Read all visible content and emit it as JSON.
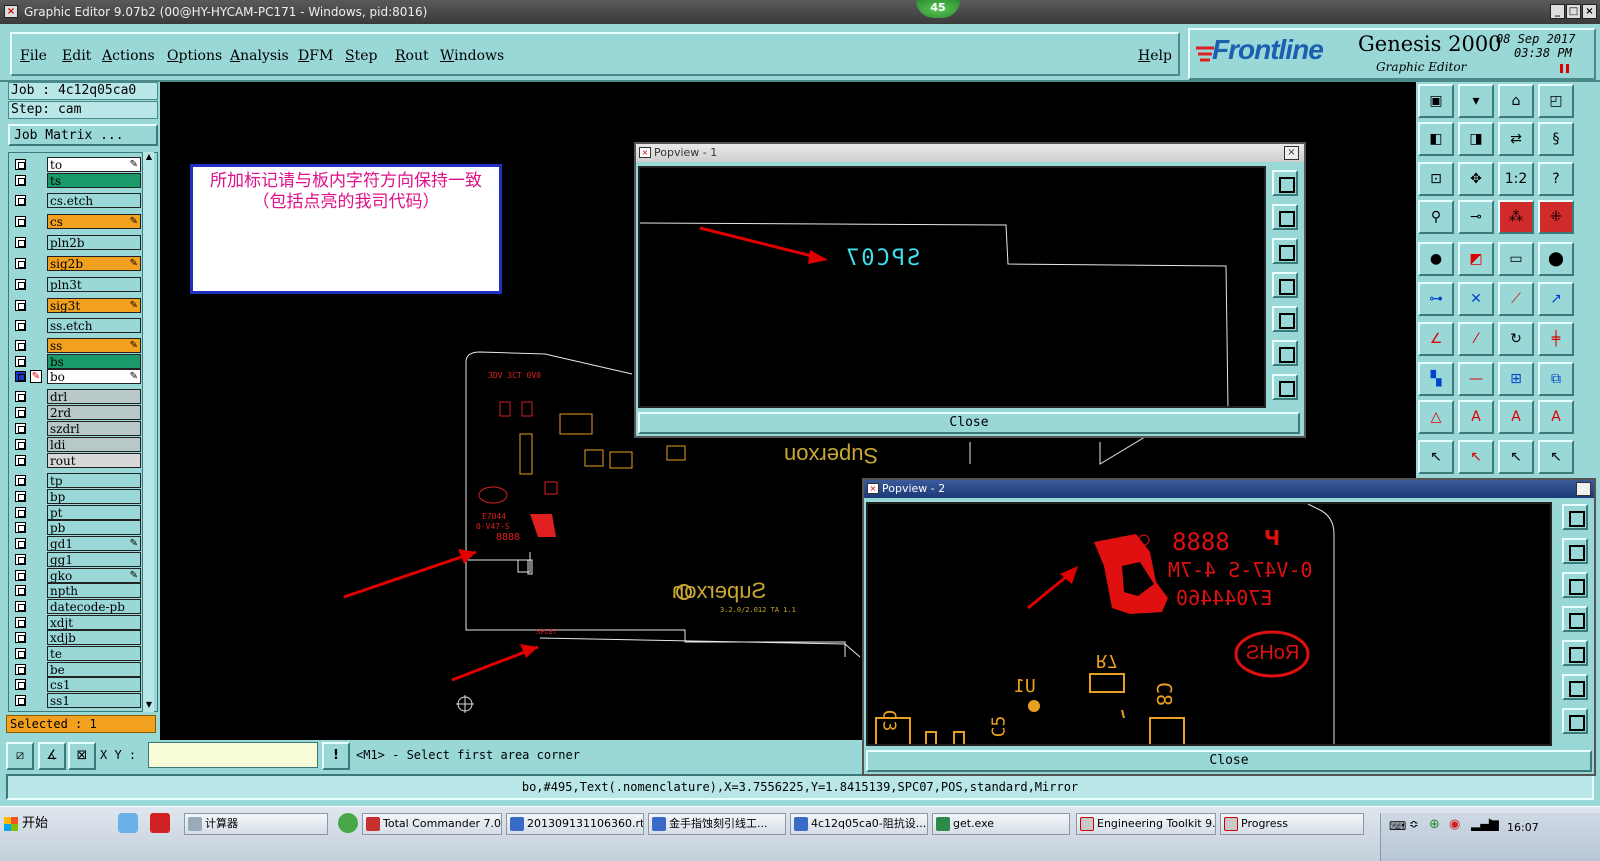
{
  "window": {
    "title": "Graphic Editor 9.07b2 (00@HY-HYCAM-PC171 - Windows, pid:8016)",
    "badge": "45"
  },
  "menus": [
    "File",
    "Edit",
    "Actions",
    "Options",
    "Analysis",
    "DFM",
    "Step",
    "Rout",
    "Windows"
  ],
  "help_label": "Help",
  "logo": {
    "brand": "Frontline",
    "product": "Genesis 2000",
    "subtitle": "Graphic Editor",
    "date": "08 Sep 2017",
    "time": "03:38 PM"
  },
  "job": {
    "job_label": "Job : 4c12q05ca0",
    "step_label": "Step: cam",
    "matrix_button": "Job Matrix ...",
    "selected": "Selected : 1"
  },
  "layers": [
    {
      "name": "to",
      "color": "#ffffff",
      "pen": true
    },
    {
      "name": "ts",
      "color": "#1a9a6a",
      "pen": false
    },
    {
      "name": "cs.etch",
      "color": "#9ad8d8",
      "pen": false
    },
    {
      "name": "cs",
      "color": "#f2a020",
      "pen": true
    },
    {
      "name": "pln2b",
      "color": "#9ad8d8",
      "pen": false
    },
    {
      "name": "sig2b",
      "color": "#f2a020",
      "pen": true
    },
    {
      "name": "pln3t",
      "color": "#9ad8d8",
      "pen": false
    },
    {
      "name": "sig3t",
      "color": "#f2a020",
      "pen": true
    },
    {
      "name": "ss.etch",
      "color": "#9ad8d8",
      "pen": false
    },
    {
      "name": "ss",
      "color": "#f2a020",
      "pen": true
    },
    {
      "name": "bs",
      "color": "#1a9a6a",
      "pen": false
    },
    {
      "name": "bo",
      "color": "#ffffff",
      "pen": true
    },
    {
      "name": "drl",
      "color": "#b8c8c8",
      "pen": false
    },
    {
      "name": "2rd",
      "color": "#b8c8c8",
      "pen": false
    },
    {
      "name": "szdrl",
      "color": "#b8c8c8",
      "pen": false
    },
    {
      "name": "ldi",
      "color": "#b8c8c8",
      "pen": false
    },
    {
      "name": "rout",
      "color": "#d8d8d8",
      "pen": false
    },
    {
      "name": "tp",
      "color": "#9ad8d8",
      "pen": false
    },
    {
      "name": "bp",
      "color": "#9ad8d8",
      "pen": false
    },
    {
      "name": "pt",
      "color": "#9ad8d8",
      "pen": false
    },
    {
      "name": "pb",
      "color": "#9ad8d8",
      "pen": false
    },
    {
      "name": "gd1",
      "color": "#9ad8d8",
      "pen": true
    },
    {
      "name": "gg1",
      "color": "#9ad8d8",
      "pen": false
    },
    {
      "name": "gko",
      "color": "#9ad8d8",
      "pen": true
    },
    {
      "name": "npth",
      "color": "#9ad8d8",
      "pen": false
    },
    {
      "name": "datecode-pb",
      "color": "#9ad8d8",
      "pen": false
    },
    {
      "name": "xdjt",
      "color": "#9ad8d8",
      "pen": false
    },
    {
      "name": "xdjb",
      "color": "#9ad8d8",
      "pen": false
    },
    {
      "name": "te",
      "color": "#9ad8d8",
      "pen": false
    },
    {
      "name": "be",
      "color": "#9ad8d8",
      "pen": false
    },
    {
      "name": "cs1",
      "color": "#9ad8d8",
      "pen": false
    },
    {
      "name": "ss1",
      "color": "#9ad8d8",
      "pen": false
    }
  ],
  "note": {
    "text": "所加标记请与板内字符方向保持一致（包括点亮的我司代码）"
  },
  "board_text": {
    "superxon1": "Superxon",
    "superxon2": "Superxon",
    "spc07": "SPC07",
    "popview_code": "8888",
    "popview_line2": "0-V47-S 4-7M",
    "popview_line3": "E7044460",
    "rohs": "RoHS",
    "r7": "R7",
    "u1": "U1",
    "c8": "C8",
    "c5": "C5",
    "c3": "C3"
  },
  "popview1": {
    "title": "Popview - 1",
    "close_label": "Close"
  },
  "popview2": {
    "title": "Popview - 2",
    "close_label": "Close"
  },
  "command": {
    "xy_label": "X Y :",
    "xy_value": "",
    "prompt": "<M1> - Select first area corner"
  },
  "status_line": "bo,#495,Text(.nomenclature),X=3.7556225,Y=1.8415139,SPC07,POS,standard,Mirror",
  "taskbar": {
    "start": "开始",
    "items": [
      "计算器",
      "Total Commander 7.0...",
      "201309131106360.rt...",
      "金手指蚀刻引线工...",
      "4c12q05ca0-阻抗设...",
      "get.exe",
      "Engineering Toolkit 9....",
      "Progress"
    ],
    "clock": "16:07"
  },
  "colors": {
    "panel": "#9ad8d8",
    "canvas": "#000000",
    "silk_yellow": "#c8a830",
    "annotation_red": "#e00000",
    "note_text": "#e0108a",
    "spc_cyan": "#40e0f0"
  }
}
